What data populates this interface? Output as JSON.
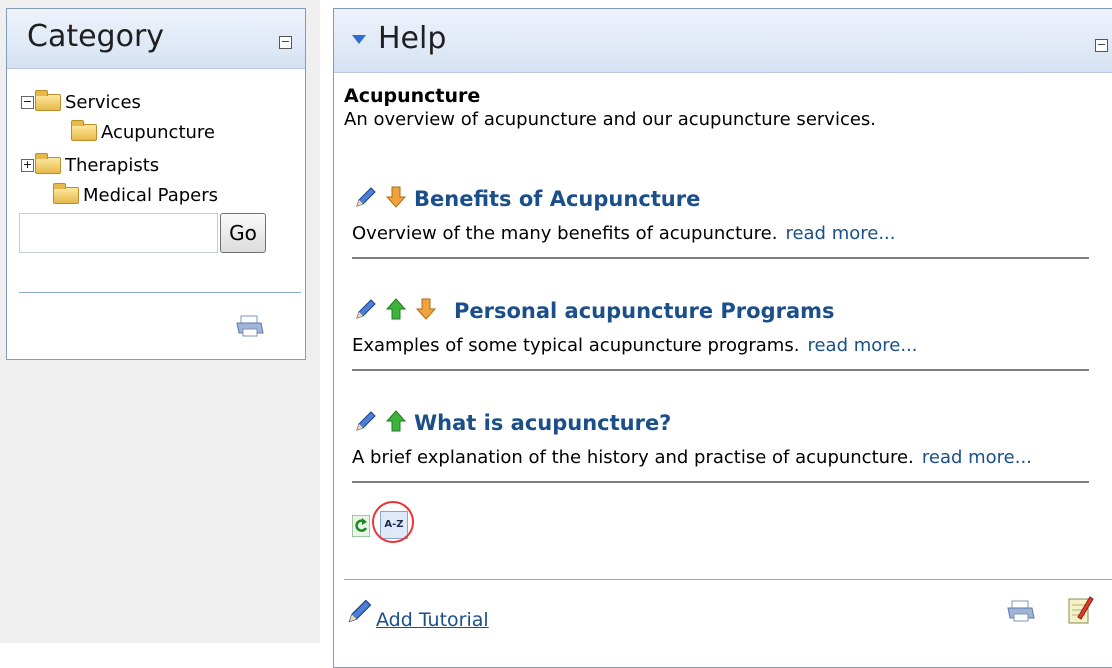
{
  "category_panel": {
    "title": "Category",
    "collapse_symbol": "−",
    "tree": [
      {
        "label": "Services",
        "toggle": "−",
        "level": 0
      },
      {
        "label": "Acupuncture",
        "toggle": "",
        "level": 1
      },
      {
        "label": "Therapists",
        "toggle": "+",
        "level": 0
      },
      {
        "label": "Medical Papers",
        "toggle": "",
        "level": 0
      }
    ],
    "search": {
      "value": "",
      "placeholder": ""
    },
    "go_label": "Go",
    "footer_icon": "print-icon"
  },
  "help_panel": {
    "title": "Help",
    "collapse_symbol": "−",
    "section_title": "Acupuncture",
    "section_description": "An overview of acupuncture and our acupuncture services.",
    "items": [
      {
        "title": "Benefits of Acupuncture",
        "description": "Overview of the many benefits of acupuncture.",
        "read_more": "read more...",
        "icons": [
          "edit-pencil-icon",
          "move-down-arrow-icon"
        ]
      },
      {
        "title": "Personal acupuncture Programs",
        "description": "Examples of some typical acupuncture programs.",
        "read_more": "read more...",
        "icons": [
          "edit-pencil-icon",
          "move-up-arrow-icon",
          "move-down-arrow-icon"
        ]
      },
      {
        "title": "What is acupuncture?",
        "description": "A brief explanation of the history and practise of acupuncture.",
        "read_more": "read more...",
        "icons": [
          "edit-pencil-icon",
          "move-up-arrow-icon"
        ]
      }
    ],
    "bottom_icons": {
      "refresh": "refresh-icon",
      "sort_label": "A-Z"
    },
    "add_tutorial_label": "Add Tutorial",
    "footer_icons": [
      "print-icon",
      "notes-icon"
    ]
  },
  "colors": {
    "accent": "#2a6fd1",
    "link": "#1a4f8a",
    "highlight": "#ee3333",
    "arrow_up": "#2fa02f",
    "arrow_down": "#e08a2a",
    "folder": "#e8b84a"
  }
}
